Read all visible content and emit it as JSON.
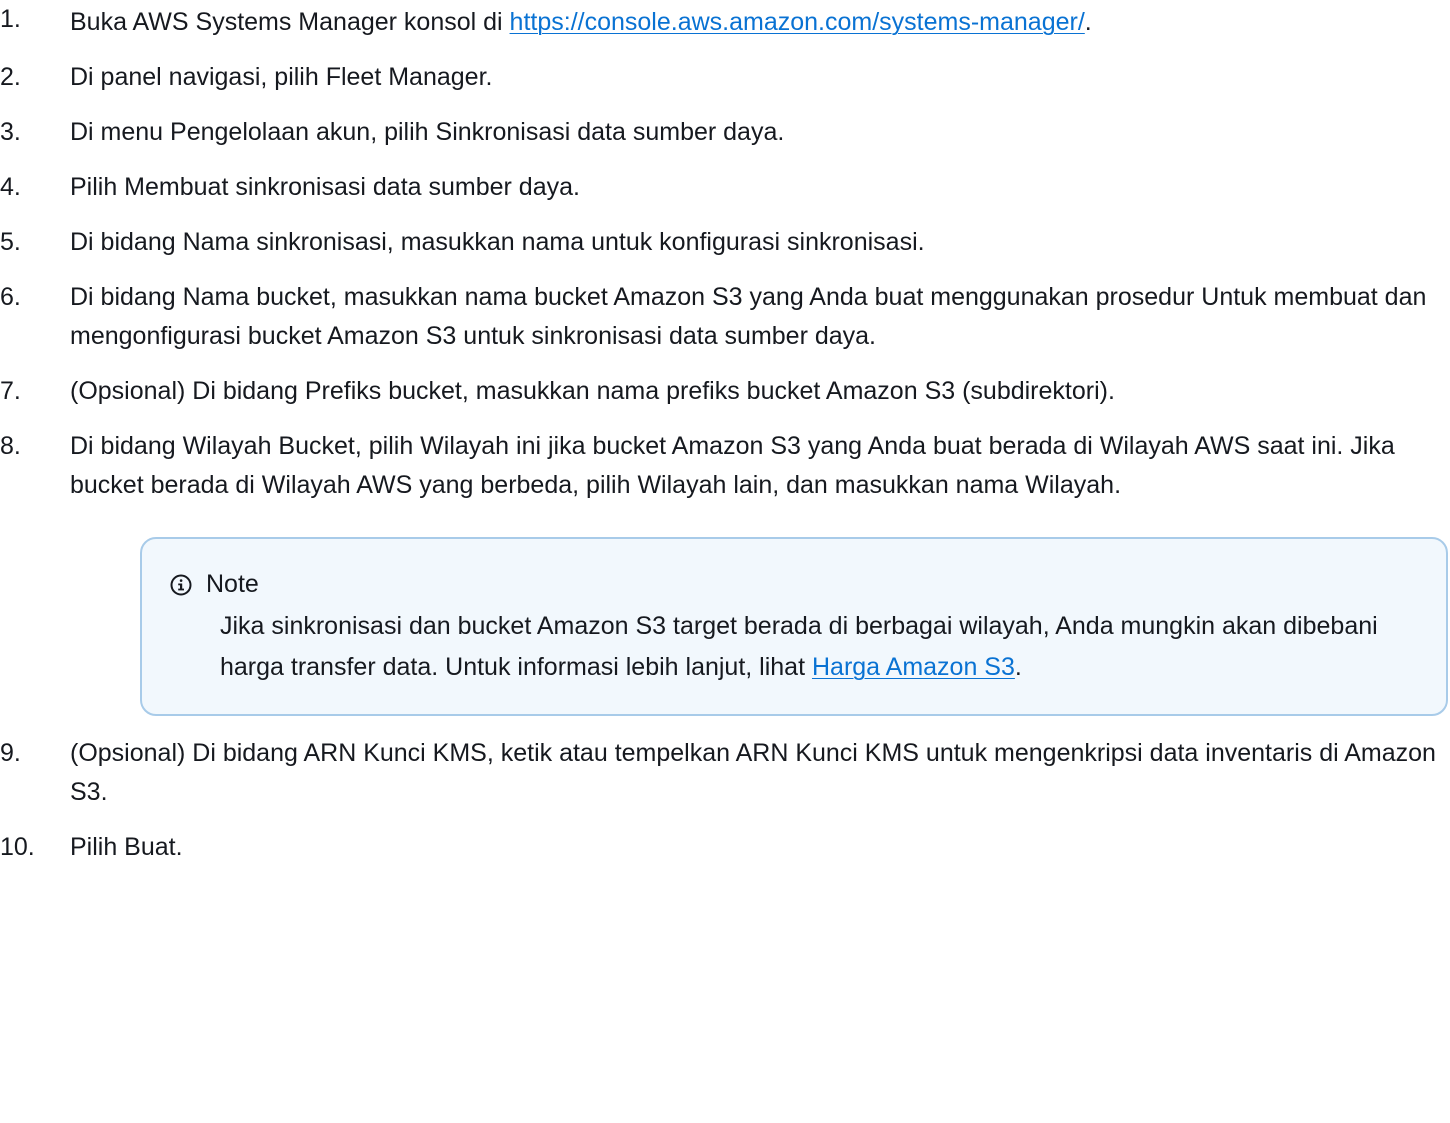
{
  "steps": [
    {
      "num": "1.",
      "pre": "Buka AWS Systems Manager konsol di ",
      "link": "https://console.aws.amazon.com/systems-manager/",
      "post": "."
    },
    {
      "num": "2.",
      "text": "Di panel navigasi, pilih Fleet Manager."
    },
    {
      "num": "3.",
      "text": "Di menu Pengelolaan akun, pilih Sinkronisasi data sumber daya."
    },
    {
      "num": "4.",
      "text": "Pilih Membuat sinkronisasi data sumber daya."
    },
    {
      "num": "5.",
      "text": "Di bidang Nama sinkronisasi, masukkan nama untuk konfigurasi sinkronisasi."
    },
    {
      "num": "6.",
      "text": "Di bidang Nama bucket, masukkan nama bucket Amazon S3 yang Anda buat menggunakan prosedur Untuk membuat dan mengonfigurasi bucket Amazon S3 untuk sinkronisasi data sumber daya."
    },
    {
      "num": "7.",
      "text": "(Opsional) Di bidang Prefiks bucket, masukkan nama prefiks bucket Amazon S3 (subdirektori)."
    },
    {
      "num": "8.",
      "text": "Di bidang Wilayah Bucket, pilih Wilayah ini jika bucket Amazon S3 yang Anda buat berada di Wilayah AWS saat ini. Jika bucket berada di Wilayah AWS yang berbeda, pilih Wilayah lain, dan masukkan nama Wilayah."
    },
    {
      "num": "9.",
      "text": "(Opsional) Di bidang ARN Kunci KMS, ketik atau tempelkan ARN Kunci KMS untuk mengenkripsi data inventaris di Amazon S3."
    },
    {
      "num": "10.",
      "text": "Pilih Buat."
    }
  ],
  "note": {
    "icon": "info-icon",
    "title": "Note",
    "body_pre": "Jika sinkronisasi dan bucket Amazon S3 target berada di berbagai wilayah, Anda mungkin akan dibebani harga transfer data. Untuk informasi lebih lanjut, lihat ",
    "link": "Harga Amazon S3",
    "body_post": "."
  },
  "colors": {
    "link": "#0972d3",
    "note_border": "#a8cbe9",
    "note_bg": "#f2f8fd",
    "text": "#16191f"
  }
}
